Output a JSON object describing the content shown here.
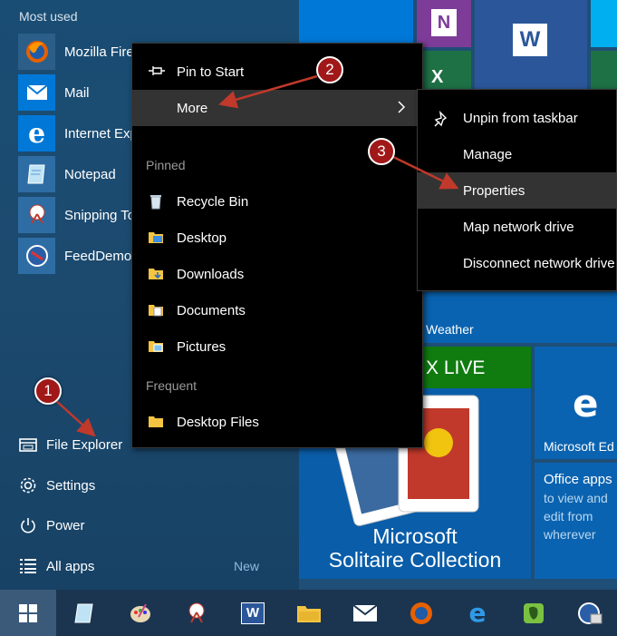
{
  "start_menu": {
    "most_used_label": "Most used",
    "apps": [
      {
        "label": "Mozilla Fire",
        "icon": "firefox-icon"
      },
      {
        "label": "Mail",
        "icon": "mail-icon"
      },
      {
        "label": "Internet Exp",
        "icon": "internet-explorer-icon"
      },
      {
        "label": "Notepad",
        "icon": "notepad-icon"
      },
      {
        "label": "Snipping To",
        "icon": "snipping-tool-icon"
      },
      {
        "label": "FeedDemo",
        "icon": "feeddemon-icon"
      }
    ],
    "bottom": {
      "file_explorer": "File Explorer",
      "settings": "Settings",
      "power": "Power",
      "all_apps": "All apps",
      "new_badge": "New"
    }
  },
  "context_menu": {
    "pin_to_start": "Pin to Start",
    "more": "More",
    "pinned_heading": "Pinned",
    "pinned": [
      "Recycle Bin",
      "Desktop",
      "Downloads",
      "Documents",
      "Pictures"
    ],
    "frequent_heading": "Frequent",
    "frequent": [
      "Desktop Files"
    ]
  },
  "submenu": {
    "items": [
      "Unpin from taskbar",
      "Manage",
      "Properties",
      "Map network drive",
      "Disconnect network drive"
    ]
  },
  "tiles": {
    "weather": "Weather",
    "xbox_live": "X LIVE",
    "solitaire_line1": "Microsoft",
    "solitaire_line2": "Solitaire Collection",
    "edge": "Microsoft Ed",
    "office_title": "Office apps",
    "office_desc": [
      "to view and",
      "edit from",
      "wherever"
    ]
  },
  "annotations": {
    "marker1": "1",
    "marker2": "2",
    "marker3": "3"
  },
  "colors": {
    "accent": "#0078d7",
    "marker": "#a01818",
    "menu_bg": "#000000",
    "highlight": "#333333"
  }
}
